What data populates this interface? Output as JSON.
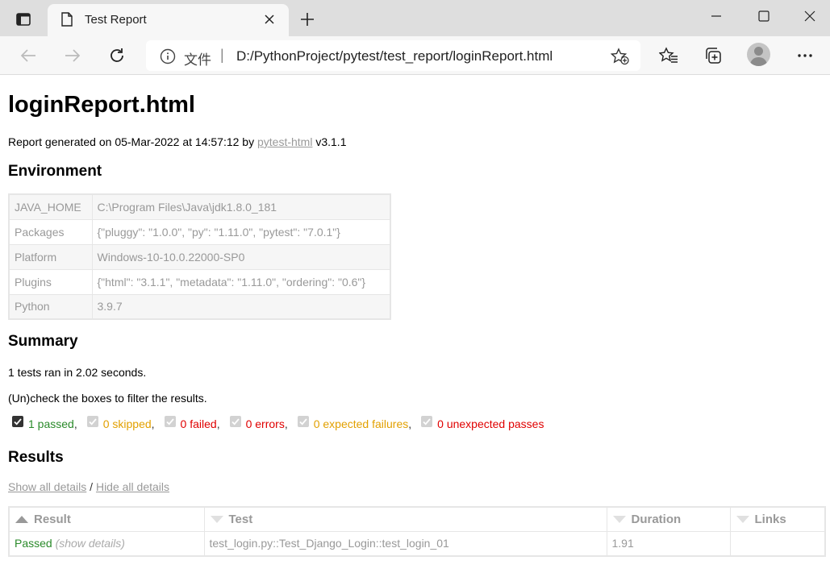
{
  "browser": {
    "tab_title": "Test Report",
    "address_scheme": "文件",
    "address_separator": "|",
    "url": "D:/PythonProject/pytest/test_report/loginReport.html"
  },
  "report": {
    "title": "loginReport.html",
    "generated_prefix": "Report generated on 05-Mar-2022 at 14:57:12 by ",
    "generator_link": "pytest-html",
    "generator_version": " v3.1.1"
  },
  "environment": {
    "heading": "Environment",
    "rows": [
      {
        "key": "JAVA_HOME",
        "value": "C:\\Program Files\\Java\\jdk1.8.0_181"
      },
      {
        "key": "Packages",
        "value": "{\"pluggy\": \"1.0.0\", \"py\": \"1.11.0\", \"pytest\": \"7.0.1\"}"
      },
      {
        "key": "Platform",
        "value": "Windows-10-10.0.22000-SP0"
      },
      {
        "key": "Plugins",
        "value": "{\"html\": \"3.1.1\", \"metadata\": \"1.11.0\", \"ordering\": \"0.6\"}"
      },
      {
        "key": "Python",
        "value": "3.9.7"
      }
    ]
  },
  "summary": {
    "heading": "Summary",
    "ran": "1 tests ran in 2.02 seconds.",
    "hint": "(Un)check the boxes to filter the results.",
    "filters": [
      {
        "label": "1 passed",
        "checked": true,
        "color": "#2a8a2a"
      },
      {
        "label": "0 skipped",
        "checked": true,
        "color": "#e2a000"
      },
      {
        "label": "0 failed",
        "checked": true,
        "color": "#e00000"
      },
      {
        "label": "0 errors",
        "checked": true,
        "color": "#e00000"
      },
      {
        "label": "0 expected failures",
        "checked": true,
        "color": "#e2a000"
      },
      {
        "label": "0 unexpected passes",
        "checked": true,
        "color": "#e00000"
      }
    ]
  },
  "results": {
    "heading": "Results",
    "show_all": "Show all details",
    "divider": " / ",
    "hide_all": "Hide all details",
    "columns": [
      "Result",
      "Test",
      "Duration",
      "Links"
    ],
    "rows": [
      {
        "result": "Passed",
        "details": "(show details)",
        "test": "test_login.py::Test_Django_Login::test_login_01",
        "duration": "1.91",
        "links": ""
      }
    ]
  }
}
